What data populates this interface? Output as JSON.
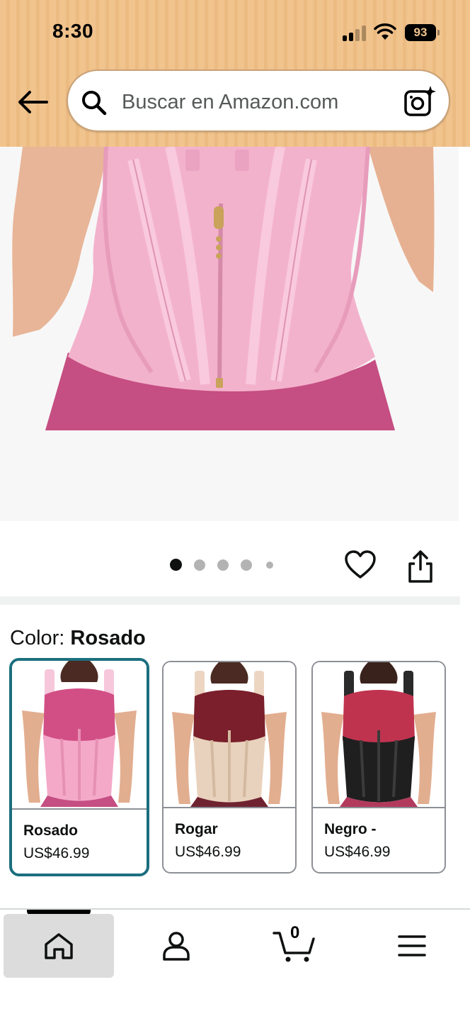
{
  "status_bar": {
    "time": "8:30",
    "battery": "93"
  },
  "header": {
    "back_icon": "arrow-left-icon",
    "search": {
      "placeholder": "Buscar en Amazon.com",
      "search_icon": "search-icon",
      "camera_icon": "camera-sparkle-icon"
    },
    "background_color": "#f1c48e"
  },
  "product_gallery": {
    "image_count": 5,
    "active_index": 0,
    "wishlist_icon": "heart-icon",
    "share_icon": "share-icon"
  },
  "color_selection": {
    "label": "Color:",
    "selected_value": "Rosado",
    "options": [
      {
        "name": "Rosado",
        "price": "US$46.99",
        "selected": true,
        "color": "#f4a9c8"
      },
      {
        "name": "Rogar",
        "price": "US$46.99",
        "selected": false,
        "color": "#e9d2bd"
      },
      {
        "name": "Negro -",
        "price": "US$46.99",
        "selected": false,
        "color": "#1f1f1f"
      }
    ],
    "selected_border_color": "#1b6f7e"
  },
  "bottom_nav": {
    "items": [
      {
        "icon": "home-icon",
        "active": true
      },
      {
        "icon": "account-icon",
        "active": false
      },
      {
        "icon": "cart-icon",
        "active": false
      },
      {
        "icon": "menu-icon",
        "active": false
      }
    ],
    "cart_count": "0"
  }
}
